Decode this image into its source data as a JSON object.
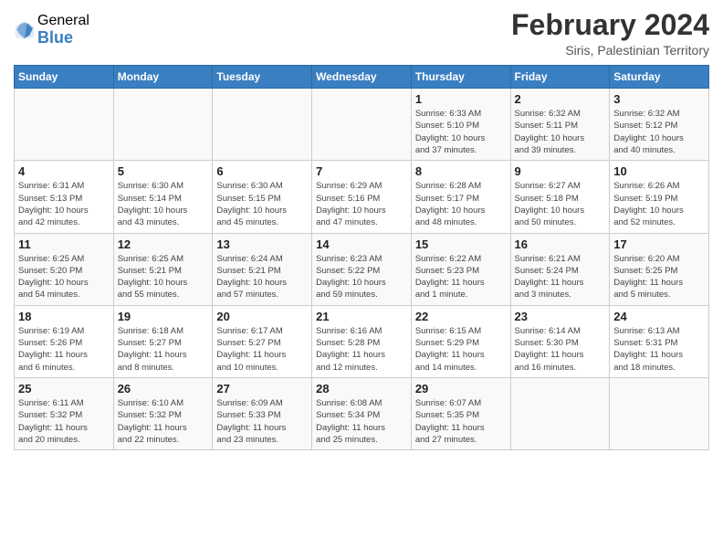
{
  "header": {
    "logo_general": "General",
    "logo_blue": "Blue",
    "month_title": "February 2024",
    "location": "Siris, Palestinian Territory"
  },
  "days_of_week": [
    "Sunday",
    "Monday",
    "Tuesday",
    "Wednesday",
    "Thursday",
    "Friday",
    "Saturday"
  ],
  "weeks": [
    [
      {
        "day": "",
        "info": ""
      },
      {
        "day": "",
        "info": ""
      },
      {
        "day": "",
        "info": ""
      },
      {
        "day": "",
        "info": ""
      },
      {
        "day": "1",
        "info": "Sunrise: 6:33 AM\nSunset: 5:10 PM\nDaylight: 10 hours\nand 37 minutes."
      },
      {
        "day": "2",
        "info": "Sunrise: 6:32 AM\nSunset: 5:11 PM\nDaylight: 10 hours\nand 39 minutes."
      },
      {
        "day": "3",
        "info": "Sunrise: 6:32 AM\nSunset: 5:12 PM\nDaylight: 10 hours\nand 40 minutes."
      }
    ],
    [
      {
        "day": "4",
        "info": "Sunrise: 6:31 AM\nSunset: 5:13 PM\nDaylight: 10 hours\nand 42 minutes."
      },
      {
        "day": "5",
        "info": "Sunrise: 6:30 AM\nSunset: 5:14 PM\nDaylight: 10 hours\nand 43 minutes."
      },
      {
        "day": "6",
        "info": "Sunrise: 6:30 AM\nSunset: 5:15 PM\nDaylight: 10 hours\nand 45 minutes."
      },
      {
        "day": "7",
        "info": "Sunrise: 6:29 AM\nSunset: 5:16 PM\nDaylight: 10 hours\nand 47 minutes."
      },
      {
        "day": "8",
        "info": "Sunrise: 6:28 AM\nSunset: 5:17 PM\nDaylight: 10 hours\nand 48 minutes."
      },
      {
        "day": "9",
        "info": "Sunrise: 6:27 AM\nSunset: 5:18 PM\nDaylight: 10 hours\nand 50 minutes."
      },
      {
        "day": "10",
        "info": "Sunrise: 6:26 AM\nSunset: 5:19 PM\nDaylight: 10 hours\nand 52 minutes."
      }
    ],
    [
      {
        "day": "11",
        "info": "Sunrise: 6:25 AM\nSunset: 5:20 PM\nDaylight: 10 hours\nand 54 minutes."
      },
      {
        "day": "12",
        "info": "Sunrise: 6:25 AM\nSunset: 5:21 PM\nDaylight: 10 hours\nand 55 minutes."
      },
      {
        "day": "13",
        "info": "Sunrise: 6:24 AM\nSunset: 5:21 PM\nDaylight: 10 hours\nand 57 minutes."
      },
      {
        "day": "14",
        "info": "Sunrise: 6:23 AM\nSunset: 5:22 PM\nDaylight: 10 hours\nand 59 minutes."
      },
      {
        "day": "15",
        "info": "Sunrise: 6:22 AM\nSunset: 5:23 PM\nDaylight: 11 hours\nand 1 minute."
      },
      {
        "day": "16",
        "info": "Sunrise: 6:21 AM\nSunset: 5:24 PM\nDaylight: 11 hours\nand 3 minutes."
      },
      {
        "day": "17",
        "info": "Sunrise: 6:20 AM\nSunset: 5:25 PM\nDaylight: 11 hours\nand 5 minutes."
      }
    ],
    [
      {
        "day": "18",
        "info": "Sunrise: 6:19 AM\nSunset: 5:26 PM\nDaylight: 11 hours\nand 6 minutes."
      },
      {
        "day": "19",
        "info": "Sunrise: 6:18 AM\nSunset: 5:27 PM\nDaylight: 11 hours\nand 8 minutes."
      },
      {
        "day": "20",
        "info": "Sunrise: 6:17 AM\nSunset: 5:27 PM\nDaylight: 11 hours\nand 10 minutes."
      },
      {
        "day": "21",
        "info": "Sunrise: 6:16 AM\nSunset: 5:28 PM\nDaylight: 11 hours\nand 12 minutes."
      },
      {
        "day": "22",
        "info": "Sunrise: 6:15 AM\nSunset: 5:29 PM\nDaylight: 11 hours\nand 14 minutes."
      },
      {
        "day": "23",
        "info": "Sunrise: 6:14 AM\nSunset: 5:30 PM\nDaylight: 11 hours\nand 16 minutes."
      },
      {
        "day": "24",
        "info": "Sunrise: 6:13 AM\nSunset: 5:31 PM\nDaylight: 11 hours\nand 18 minutes."
      }
    ],
    [
      {
        "day": "25",
        "info": "Sunrise: 6:11 AM\nSunset: 5:32 PM\nDaylight: 11 hours\nand 20 minutes."
      },
      {
        "day": "26",
        "info": "Sunrise: 6:10 AM\nSunset: 5:32 PM\nDaylight: 11 hours\nand 22 minutes."
      },
      {
        "day": "27",
        "info": "Sunrise: 6:09 AM\nSunset: 5:33 PM\nDaylight: 11 hours\nand 23 minutes."
      },
      {
        "day": "28",
        "info": "Sunrise: 6:08 AM\nSunset: 5:34 PM\nDaylight: 11 hours\nand 25 minutes."
      },
      {
        "day": "29",
        "info": "Sunrise: 6:07 AM\nSunset: 5:35 PM\nDaylight: 11 hours\nand 27 minutes."
      },
      {
        "day": "",
        "info": ""
      },
      {
        "day": "",
        "info": ""
      }
    ]
  ]
}
